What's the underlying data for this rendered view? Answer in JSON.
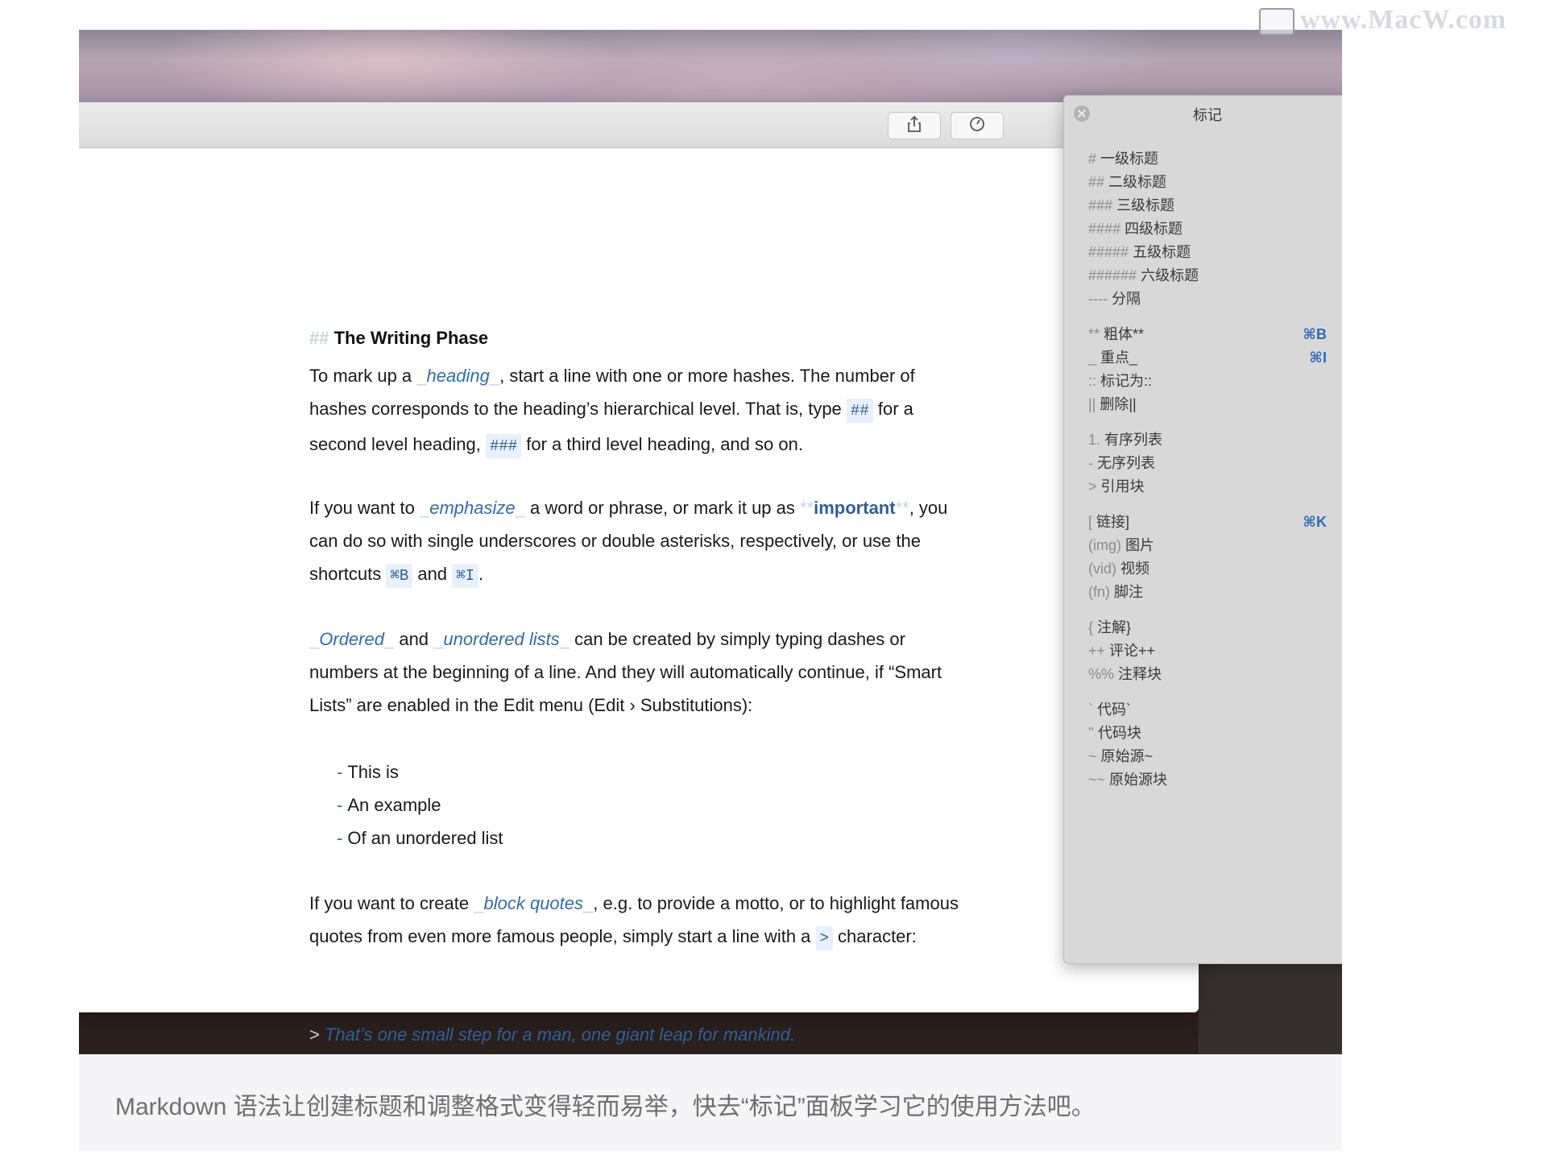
{
  "editor": {
    "heading_marker": "##",
    "heading": "The Writing Phase",
    "p1": {
      "t1": "To mark up a ",
      "link": "heading",
      "t2": ", start a line with one or more hashes. The number of hashes corresponds to the heading’s hierarchical level. That is, type ",
      "code1": "##",
      "t3": " for a second level heading, ",
      "code2": "###",
      "t4": " for a third level heading, and so on."
    },
    "p2": {
      "t1": "If you want to ",
      "link": "emphasize",
      "t2": " a word or phrase, or mark it up as ",
      "strong": "important",
      "t3": ", you can do so with single underscores or double asterisks, respectively, or use the shortcuts ",
      "code1": "⌘B",
      "t4": " and ",
      "code2": "⌘I",
      "t5": "."
    },
    "p3": {
      "link1": "Ordered",
      "t1": " and ",
      "link2": "unordered lists",
      "t2": " can be created by simply typing dashes or numbers at the beginning of a line. And they will automatically continue, if “Smart Lists” are enabled in the Edit menu (Edit › Substitutions):"
    },
    "list_marker": "-",
    "list_items": [
      "This is",
      "An example",
      "Of an unordered list"
    ],
    "p4": {
      "t1": "If you want to create ",
      "link": "block quotes",
      "t2": ", e.g. to provide a motto, or to highlight famous quotes from even more famous people, simply start a line with a ",
      "code1": ">",
      "t3": " character:"
    },
    "quote_marker": ">",
    "quote": "That’s one small step for a man, one giant leap for mankind."
  },
  "panel": {
    "title": "标记",
    "items": [
      {
        "mk": "#",
        "label": "一级标题",
        "shortcut": ""
      },
      {
        "mk": "##",
        "label": "二级标题",
        "shortcut": ""
      },
      {
        "mk": "###",
        "label": "三级标题",
        "shortcut": ""
      },
      {
        "mk": "####",
        "label": "四级标题",
        "shortcut": ""
      },
      {
        "mk": "#####",
        "label": "五级标题",
        "shortcut": ""
      },
      {
        "mk": "######",
        "label": "六级标题",
        "shortcut": ""
      },
      {
        "mk": "----",
        "label": "分隔",
        "shortcut": ""
      },
      {
        "mk": "**",
        "label": "粗体**",
        "shortcut": "⌘B"
      },
      {
        "mk": "_",
        "label": "重点_",
        "shortcut": "⌘I"
      },
      {
        "mk": "::",
        "label": "标记为::",
        "shortcut": ""
      },
      {
        "mk": "||",
        "label": "删除||",
        "shortcut": ""
      },
      {
        "mk": "1.",
        "label": "有序列表",
        "shortcut": ""
      },
      {
        "mk": "-",
        "label": "无序列表",
        "shortcut": ""
      },
      {
        "mk": ">",
        "label": "引用块",
        "shortcut": ""
      },
      {
        "mk": "[",
        "label": "链接]",
        "shortcut": "⌘K"
      },
      {
        "mk": "(img)",
        "label": "图片",
        "shortcut": ""
      },
      {
        "mk": "(vid)",
        "label": "视频",
        "shortcut": ""
      },
      {
        "mk": "(fn)",
        "label": "脚注",
        "shortcut": ""
      },
      {
        "mk": "{",
        "label": "注解}",
        "shortcut": ""
      },
      {
        "mk": "++",
        "label": "评论++",
        "shortcut": ""
      },
      {
        "mk": "%%",
        "label": "注释块",
        "shortcut": ""
      },
      {
        "mk": "`",
        "label": "代码`",
        "shortcut": ""
      },
      {
        "mk": "''",
        "label": "代码块",
        "shortcut": ""
      },
      {
        "mk": "~",
        "label": "原始源~",
        "shortcut": ""
      },
      {
        "mk": "~~",
        "label": "原始源块",
        "shortcut": ""
      }
    ]
  },
  "caption": "Markdown 语法让创建标题和调整格式变得轻而易举，快去“标记”面板学习它的使用方法吧。",
  "watermark": "www.MacW.com",
  "colors": {
    "link": "#2f6cb5",
    "code_bg": "#e7f0fb",
    "panel_bg": "#d8d8d8",
    "caption_bg": "#f5f5f7"
  },
  "icons": [
    "share-icon",
    "stats-icon",
    "close-icon"
  ]
}
